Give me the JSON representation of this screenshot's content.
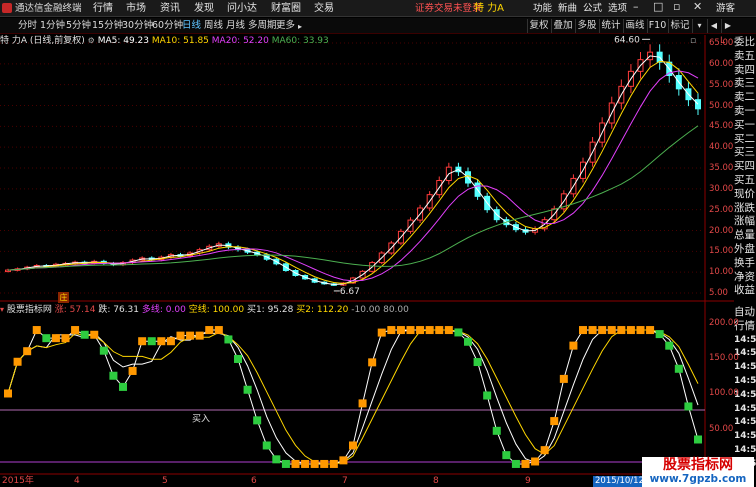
{
  "titlebar": {
    "app_title": "通达信金融终端",
    "menus": [
      "行情",
      "市场",
      "资讯",
      "发现",
      "问小达",
      "财富圈",
      "交易"
    ],
    "login_status": "证券交易未登录",
    "stock_name": "特 力A",
    "right_menus": [
      "功能",
      "新曲",
      "公式",
      "选项",
      "游客"
    ]
  },
  "toolbar": {
    "periods": [
      "分时",
      "1分钟",
      "5分钟",
      "15分钟",
      "30分钟",
      "60分钟",
      "日线",
      "周线",
      "月线",
      "多周期",
      "更多"
    ],
    "active_period": "日线",
    "right_buttons": [
      "复权",
      "叠加",
      "多股",
      "统计",
      "画线",
      "F10",
      "标记"
    ]
  },
  "main_chart": {
    "stock_label": "特 力A (日线,前复权)",
    "ma_labels": [
      {
        "text": "MA5: 49.23",
        "color": "#ffffff"
      },
      {
        "text": "MA10: 51.85",
        "color": "#ffd700"
      },
      {
        "text": "MA20: 52.20",
        "color": "#e040fb"
      },
      {
        "text": "MA60: 33.93",
        "color": "#4caf50"
      }
    ],
    "y_ticks": [
      "65.00",
      "60.00",
      "55.00",
      "50.00",
      "45.00",
      "40.00",
      "35.00",
      "30.00",
      "25.00",
      "20.00",
      "15.00",
      "10.00",
      "5.00"
    ],
    "high_annotation": "64.60",
    "low_annotation": "6.67",
    "right_corner": "L"
  },
  "right_panel": {
    "labels": [
      "委比",
      "卖五",
      "卖四",
      "卖三",
      "卖二",
      "卖一",
      "买一",
      "买二",
      "买三",
      "买四",
      "买五",
      "现价",
      "涨跌",
      "涨幅",
      "总量",
      "外盘",
      "换手",
      "净资",
      "收益"
    ],
    "lower_labels": [
      "自动",
      "行情",
      "14:50",
      "14:50",
      "14:50",
      "14:50",
      "14:50",
      "14:50",
      "14:50",
      "14:50",
      "14:50",
      "14:50"
    ]
  },
  "indicator": {
    "name": "股票指标网",
    "badge": "庄",
    "values": [
      {
        "text": "涨: 57.14",
        "color": "#e24848"
      },
      {
        "text": "跌: 76.31",
        "color": "#e0e0e0"
      },
      {
        "text": "多线: 0.00",
        "color": "#e040fb"
      },
      {
        "text": "空线: 100.00",
        "color": "#ffd700"
      },
      {
        "text": "买1: 95.28",
        "color": "#e0e0e0"
      },
      {
        "text": "买2: 112.20",
        "color": "#ffd700"
      },
      {
        "text": "-10.00",
        "color": "#aaaaaa"
      },
      {
        "text": "80.00",
        "color": "#aaaaaa"
      }
    ],
    "y_ticks": [
      "200.00",
      "150.00",
      "100.00",
      "50.00",
      "0.00"
    ],
    "buy_label": "买入"
  },
  "x_axis": {
    "labels": [
      "2015年",
      "4",
      "5",
      "6",
      "7",
      "8",
      "9"
    ],
    "cursor_date": "2015/10/12/一"
  },
  "watermark": {
    "title": "股票指标网",
    "url": "www.7gpzb.com"
  },
  "chart_data": {
    "type": "line",
    "price_range": [
      5,
      65
    ],
    "indicator_range": [
      -10,
      200
    ],
    "price_series_close": [
      10.5,
      10.8,
      11.2,
      11.6,
      11.4,
      11.9,
      12.1,
      12.4,
      12.2,
      12.6,
      12.1,
      11.8,
      12.3,
      12.9,
      13.4,
      13.0,
      13.6,
      14.2,
      13.9,
      14.6,
      15.4,
      16.2,
      16.8,
      16.0,
      15.4,
      14.8,
      14.2,
      13.1,
      12.0,
      10.4,
      9.2,
      8.4,
      7.6,
      7.2,
      6.9,
      7.4,
      8.6,
      10.2,
      12.3,
      14.6,
      17.0,
      19.8,
      22.5,
      25.4,
      28.6,
      32.0,
      35.2,
      34.1,
      31.4,
      28.2,
      25.0,
      22.6,
      21.4,
      20.2,
      19.6,
      20.4,
      22.6,
      25.2,
      28.8,
      32.5,
      36.4,
      41.2,
      45.8,
      50.6,
      54.6,
      58.2,
      61.0,
      62.8,
      60.4,
      57.2,
      54.0,
      51.4,
      49.2
    ],
    "ma_series": [
      {
        "name": "MA5"
      },
      {
        "name": "MA10"
      },
      {
        "name": "MA20"
      },
      {
        "name": "MA60"
      }
    ]
  }
}
